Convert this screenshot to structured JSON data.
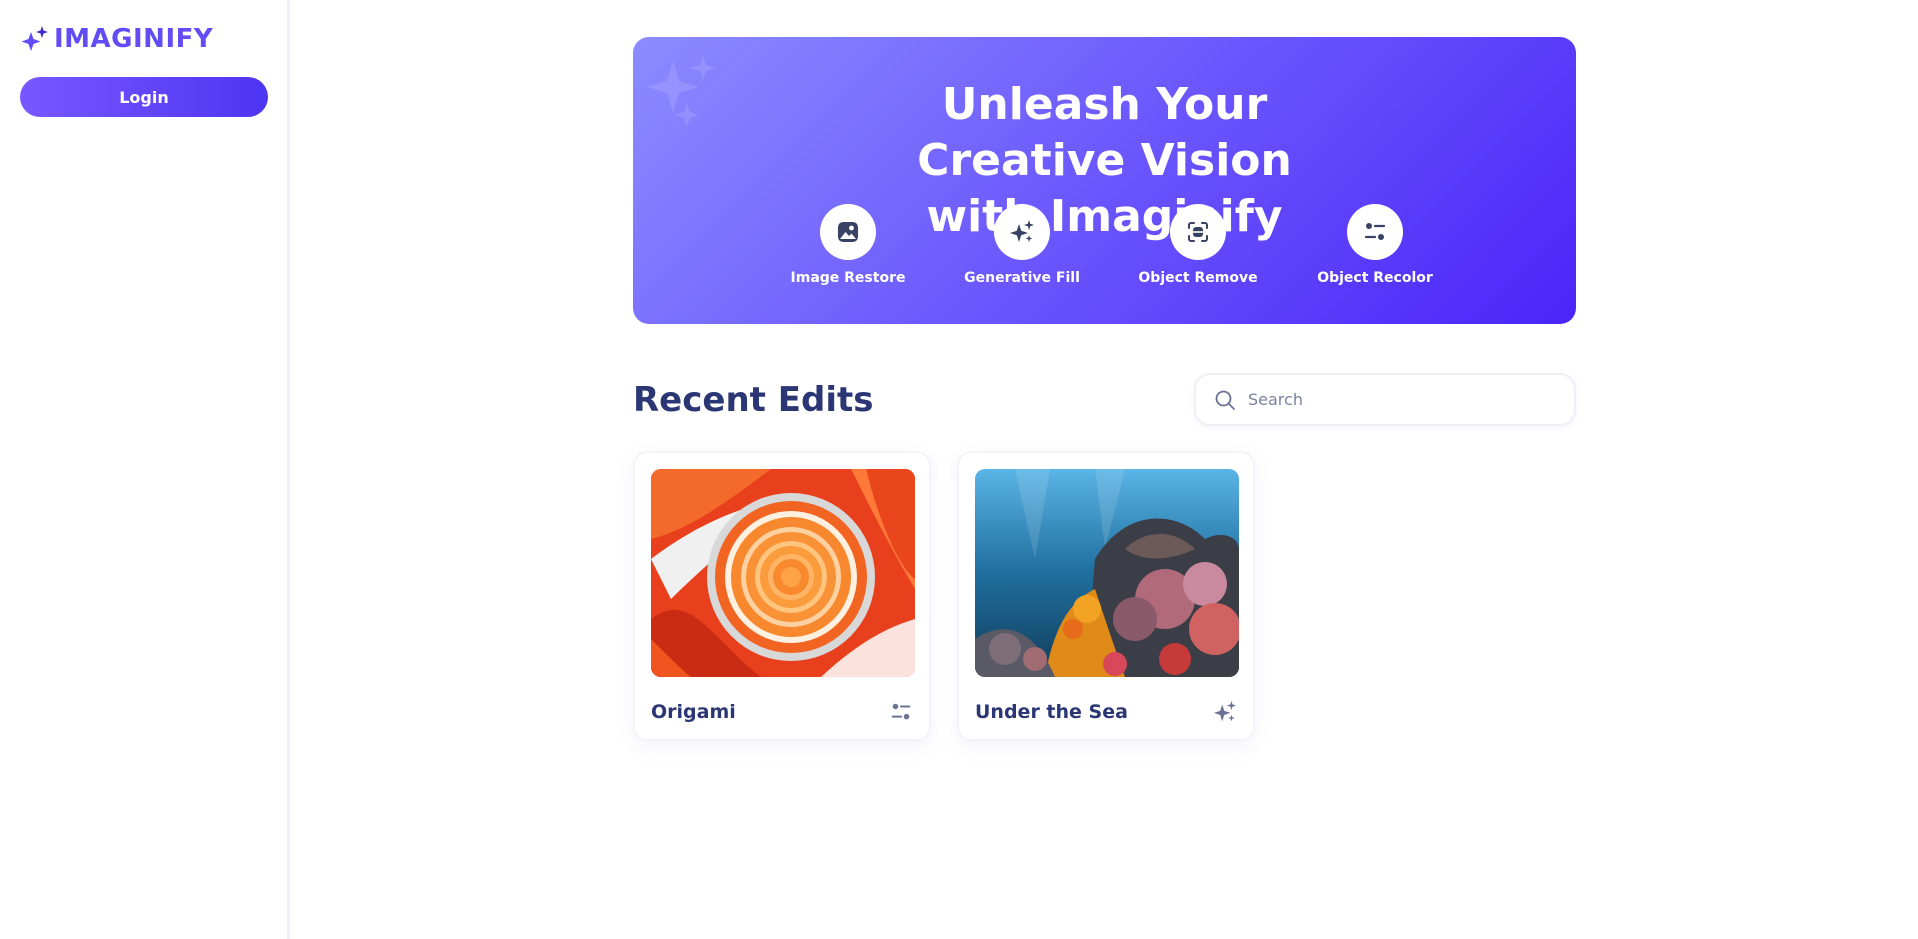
{
  "brand": {
    "name": "IMAGINIFY",
    "color": "#624cf5",
    "logo_icon": "sparkle-logo-icon"
  },
  "sidebar": {
    "login_label": "Login"
  },
  "hero": {
    "title": "Unleash Your Creative Vision with Imaginify",
    "gradient": [
      "#8c8cff",
      "#4b24f8"
    ],
    "tools": [
      {
        "label": "Image Restore",
        "icon": "image-icon"
      },
      {
        "label": "Generative Fill",
        "icon": "stars-icon"
      },
      {
        "label": "Object Remove",
        "icon": "scan-icon"
      },
      {
        "label": "Object Recolor",
        "icon": "filter-icon"
      }
    ]
  },
  "recent": {
    "title": "Recent Edits",
    "search_placeholder": "Search",
    "items": [
      {
        "name": "Origami",
        "type_icon": "filter-icon",
        "image": "orange-paper-spiral"
      },
      {
        "name": "Under the Sea",
        "type_icon": "stars-icon",
        "image": "coral-reef"
      }
    ]
  }
}
